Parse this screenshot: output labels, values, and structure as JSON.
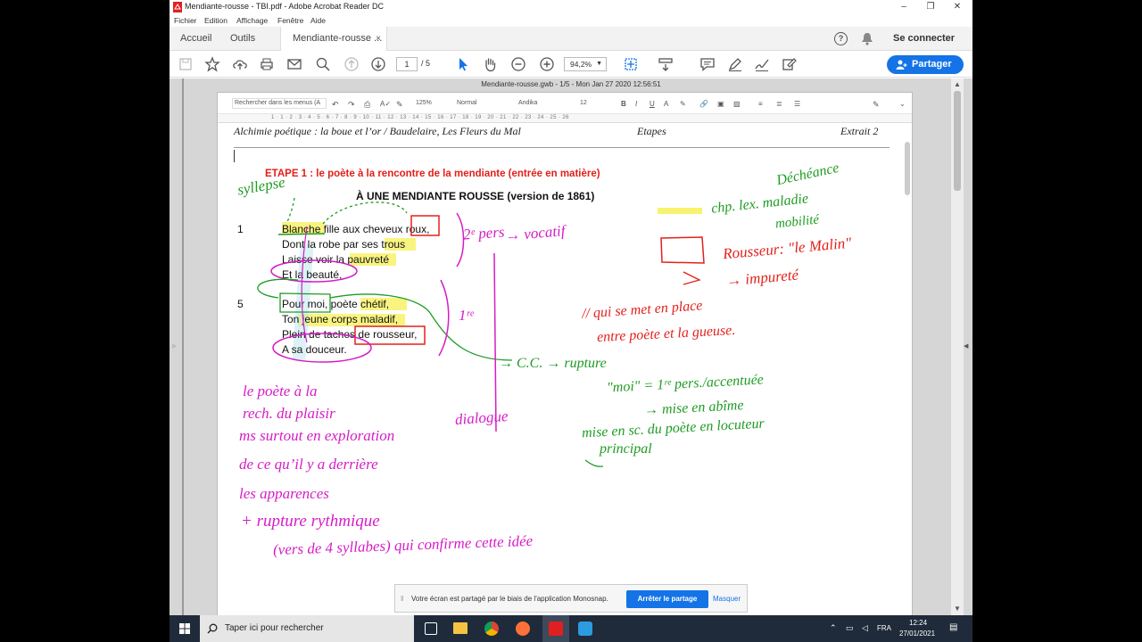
{
  "window": {
    "title": "Mendiante-rousse - TBI.pdf - Adobe Acrobat Reader DC",
    "minimize": "–",
    "restore": "❐",
    "close": "✕"
  },
  "menu": [
    "Fichier",
    "Edition",
    "Affichage",
    "Fenêtre",
    "Aide"
  ],
  "tabs": {
    "home": "Accueil",
    "tools": "Outils",
    "doc": "Mendiante-rousse ...",
    "close": "×",
    "help_icon": "?",
    "signin": "Se connecter"
  },
  "toolbar": {
    "page_current": "1",
    "page_total": "/ 5",
    "zoom": "94,2%",
    "share": "Partager"
  },
  "page_header": "Mendiante-rousse.gwb - 1/5 - Mon Jan 27 2020 12:56:51",
  "gdoc": {
    "search_placeholder": "Rechercher dans les menus (A",
    "zoom": "125%",
    "style": "Normal",
    "font": "Andika",
    "size": "12",
    "ruler": "1 · 1 · 2 · 3 · 4 · 5 · 6 · 7 · 8 · 9 · 10 · 11 · 12 · 13 · 14 · 15 · 16 · 17 · 18 · 19 · 20 · 21 · 22 · 23 · 24 · 25 · 26"
  },
  "document": {
    "header_left": "Alchimie poétique : la boue et l’or / Baudelaire, Les Fleurs du Mal",
    "header_mid": "Etapes",
    "header_right": "Extrait 2",
    "step_title": "ETAPE 1 : le poète à la rencontre de la mendiante (entrée en matière)",
    "poem_title": "À UNE MENDIANTE ROUSSE (version de 1861)",
    "line_num_1": "1",
    "line_num_5": "5",
    "stanza1": [
      "Blanche fille aux cheveux roux,",
      "Dont la robe par ses trous",
      "Laisse voir la pauvreté",
      "Et la beauté,"
    ],
    "stanza2": [
      "Pour moi, poète chétif,",
      "Ton jeune corps maladif,",
      "Plein de taches de rousseur,",
      "A sa douceur."
    ]
  },
  "annotations": {
    "syllepse": "syllepse",
    "decheance": "Déchéance",
    "champ_lex": "chp. lex. maladie",
    "mobilite": "mobilité",
    "rousseur": "Rousseur: \"le Malin\"",
    "impurete": "→ impureté",
    "deux_pers": "2ᵉ pers",
    "vocatif": "→ vocatif",
    "premiere": "1ʳᵉ",
    "qui_se_met": "// qui se met en place",
    "entre": "entre poète et la gueuse.",
    "cc": "→ C.C. → rupture",
    "moi": "\"moi\" = 1ʳᵉ pers./accentuée",
    "mise_abime": "→ mise en abîme",
    "mise_scene": "mise en sc. du poète en locuteur",
    "principal": "principal",
    "dialogue": "dialogue",
    "poete_1": "le poète à la",
    "poete_2": "rech. du plaisir",
    "poete_3": "ms surtout en exploration",
    "poete_4": "de ce qu’il y a derrière",
    "poete_5": "les apparences",
    "rupture": "+ rupture rythmique",
    "vers": "(vers de 4 syllabes) qui confirme cette idée"
  },
  "share_banner": {
    "text": "Votre écran est partagé par le biais de l'application Monosnap.",
    "stop": "Arrêter le partage",
    "hide": "Masquer"
  },
  "taskbar": {
    "search": "Taper ici pour rechercher",
    "lang": "FRA",
    "time": "12:24",
    "date": "27/01/2021"
  },
  "colors": {
    "accent": "#1473e6",
    "red": "#e3201b",
    "green": "#1e9c22",
    "magenta": "#d61cc6",
    "highlight_yellow": "#f6f04a"
  }
}
